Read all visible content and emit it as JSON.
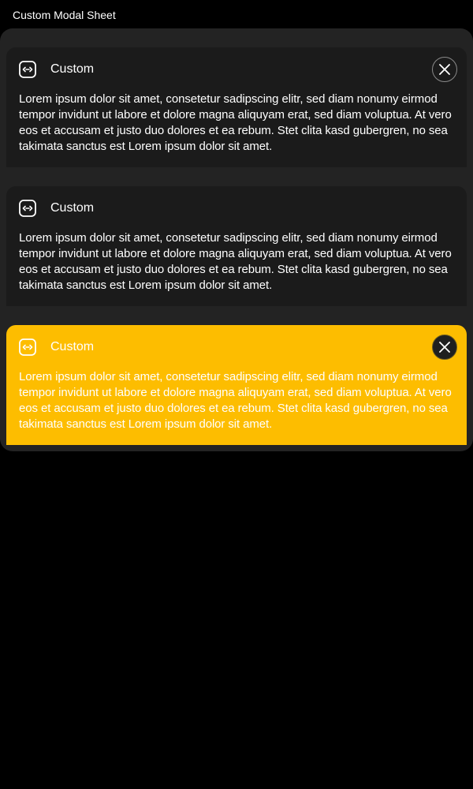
{
  "window": {
    "title": "Custom Modal Sheet"
  },
  "cards": [
    {
      "title": "Custom",
      "icon": "code-icon",
      "body": "Lorem ipsum dolor sit amet, consetetur sadipscing elitr, sed diam nonumy eirmod tempor invidunt ut labore et dolore magna aliquyam erat, sed diam voluptua. At vero eos et accusam et justo duo dolores et ea rebum. Stet clita kasd gubergren, no sea takimata sanctus est Lorem ipsum dolor sit amet.",
      "has_close": true,
      "background": "#1b1b1b"
    },
    {
      "title": "Custom",
      "icon": "code-icon",
      "body": "Lorem ipsum dolor sit amet, consetetur sadipscing elitr, sed diam nonumy eirmod tempor invidunt ut labore et dolore magna aliquyam erat, sed diam voluptua. At vero eos et accusam et justo duo dolores et ea rebum. Stet clita kasd gubergren, no sea takimata sanctus est Lorem ipsum dolor sit amet.",
      "has_close": false,
      "background": "#1b1b1b"
    },
    {
      "title": "Custom",
      "icon": "code-icon",
      "body": "Lorem ipsum dolor sit amet, consetetur sadipscing elitr, sed diam nonumy eirmod tempor invidunt ut labore et dolore magna aliquyam erat, sed diam voluptua. At vero eos et accusam et justo duo dolores et ea rebum. Stet clita kasd gubergren, no sea takimata sanctus est Lorem ipsum dolor sit amet.",
      "has_close": true,
      "background": "#fdbd00"
    }
  ],
  "colors": {
    "page_background": "#000000",
    "sheet_background": "#232323",
    "card_background": "#1b1b1b",
    "accent_yellow": "#fdbd00",
    "text": "#ffffff"
  },
  "icons": {
    "card_icon": "code-icon",
    "close": "close-icon"
  }
}
